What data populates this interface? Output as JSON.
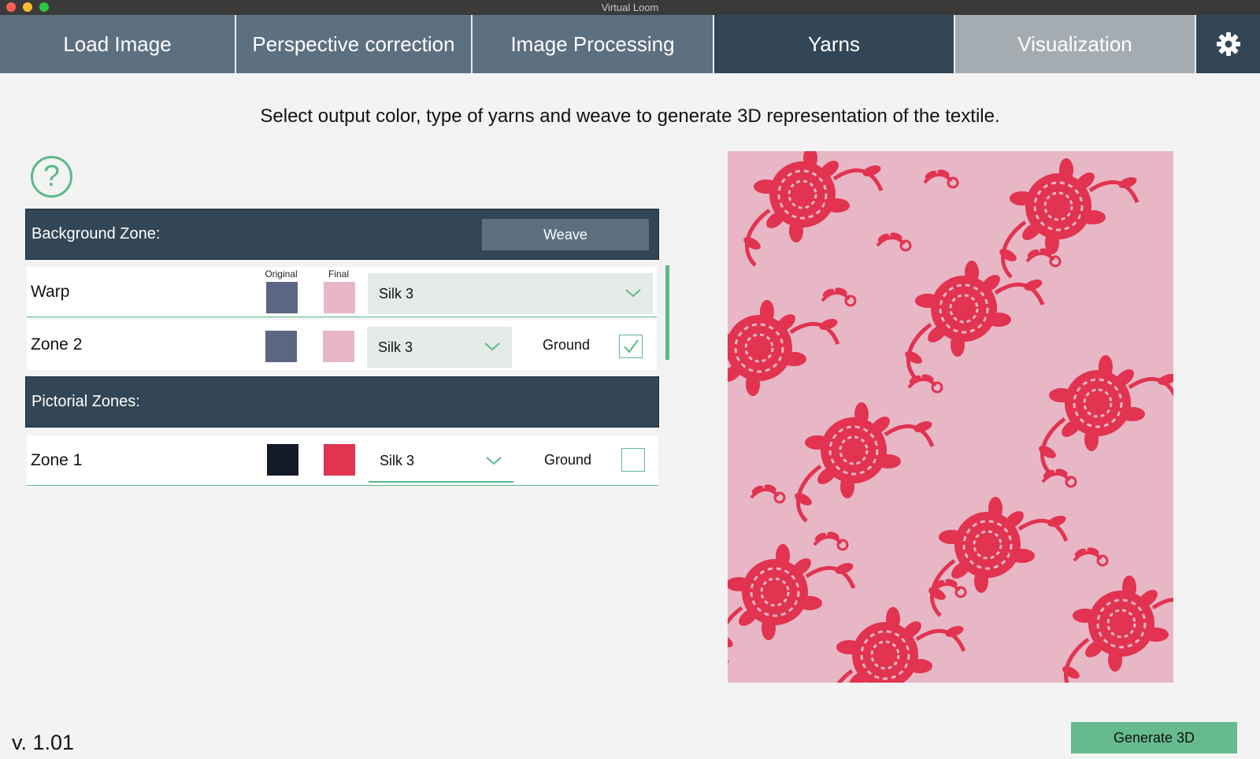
{
  "window": {
    "title": "Virtual Loom"
  },
  "tabs": [
    {
      "label": "Load Image",
      "state": "normal"
    },
    {
      "label": "Perspective correction",
      "state": "normal"
    },
    {
      "label": "Image Processing",
      "state": "normal"
    },
    {
      "label": "Yarns",
      "state": "active"
    },
    {
      "label": "Visualization",
      "state": "disabled"
    }
  ],
  "settings_icon": "gear-icon",
  "instruction": "Select output color, type of yarns and weave to generate 3D representation of the textile.",
  "help_icon": "question-circle-icon",
  "background_zone": {
    "title": "Background Zone:",
    "weave_button": "Weave",
    "col_original": "Original",
    "col_final": "Final",
    "rows": [
      {
        "name": "Warp",
        "original_color": "#5b6682",
        "final_color": "#e7b7c6",
        "yarn": "Silk 3"
      },
      {
        "name": "Zone 2",
        "original_color": "#5b6682",
        "final_color": "#e7b7c6",
        "yarn": "Silk 3",
        "ground_label": "Ground",
        "ground_checked": true
      }
    ]
  },
  "pictorial_zones": {
    "title": "Pictorial Zones:",
    "rows": [
      {
        "name": "Zone 1",
        "original_color": "#141a2a",
        "final_color": "#e23350",
        "yarn": "Silk 3",
        "ground_label": "Ground",
        "ground_checked": false
      }
    ]
  },
  "preview": {
    "background_color": "#e7b7c6",
    "motif_color": "#e23350"
  },
  "version": "v. 1.01",
  "generate_button": "Generate 3D",
  "colors": {
    "accent": "#5cb98a",
    "tab_active": "#334655",
    "tab_normal": "#5d7080",
    "tab_disabled": "#a4acb2"
  }
}
